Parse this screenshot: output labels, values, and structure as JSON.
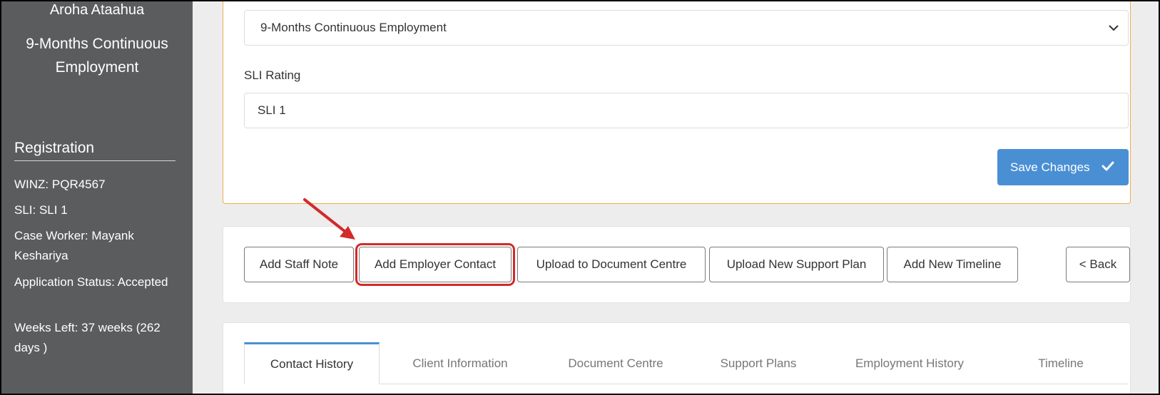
{
  "sidebar": {
    "name": "Aroha Ataahua",
    "program": "9-Months Continuous Employment",
    "section_title": "Registration",
    "info": [
      "WINZ: PQR4567",
      "SLI: SLI 1",
      "Case Worker: Mayank Keshariya",
      "Application Status: Accepted",
      "Weeks Left: 37 weeks (262 days )"
    ]
  },
  "form": {
    "program_select_value": "9-Months Continuous Employment",
    "sli_label": "SLI Rating",
    "sli_value": "SLI 1",
    "save_label": "Save Changes"
  },
  "actions": {
    "add_staff_note": "Add Staff Note",
    "add_employer_contact": "Add Employer Contact",
    "upload_document": "Upload to Document Centre",
    "upload_support_plan": "Upload New Support Plan",
    "add_timeline": "Add New Timeline",
    "back": "< Back"
  },
  "tabs": [
    {
      "label": "Contact History",
      "active": true
    },
    {
      "label": "Client Information",
      "active": false
    },
    {
      "label": "Document Centre",
      "active": false
    },
    {
      "label": "Support Plans",
      "active": false
    },
    {
      "label": "Employment History",
      "active": false
    },
    {
      "label": "Timeline",
      "active": false
    }
  ],
  "colors": {
    "sidebar_bg": "#5b5c5e",
    "primary": "#4a8fd4",
    "highlight": "#d32a2a",
    "card_accent_border": "#f0ad4e"
  },
  "icons": {
    "select_chevron": "chevron-down-icon",
    "save": "check-icon",
    "annotation": "annotation-arrow"
  }
}
